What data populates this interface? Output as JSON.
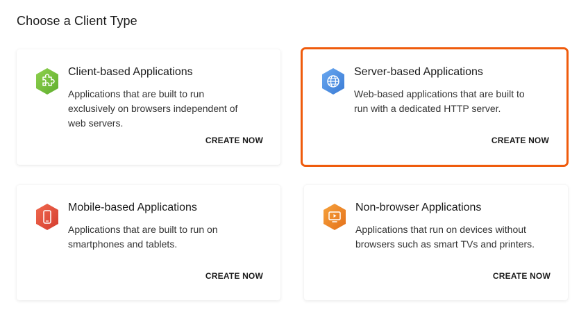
{
  "page": {
    "title": "Choose a Client Type"
  },
  "cards": [
    {
      "title": "Client-based Applications",
      "description": "Applications that are built to run exclusively on browsers independent of web servers.",
      "action": "CREATE NOW",
      "icon": "puzzle-icon",
      "icon_color": "#7ac142",
      "selected": false
    },
    {
      "title": "Server-based Applications",
      "description": "Web-based applications that are built to run with a dedicated HTTP server.",
      "action": "CREATE NOW",
      "icon": "globe-icon",
      "icon_color": "#4a8fe0",
      "selected": true
    },
    {
      "title": "Mobile-based Applications",
      "description": "Applications that are built to run on smartphones and tablets.",
      "action": "CREATE NOW",
      "icon": "smartphone-icon",
      "icon_color": "#e5533d",
      "selected": false
    },
    {
      "title": "Non-browser Applications",
      "description": "Applications that run on devices without browsers such as smart TVs and printers.",
      "action": "CREATE NOW",
      "icon": "tv-icon",
      "icon_color": "#f08a24",
      "selected": false
    }
  ],
  "colors": {
    "selection_border": "#ef5b0c"
  }
}
